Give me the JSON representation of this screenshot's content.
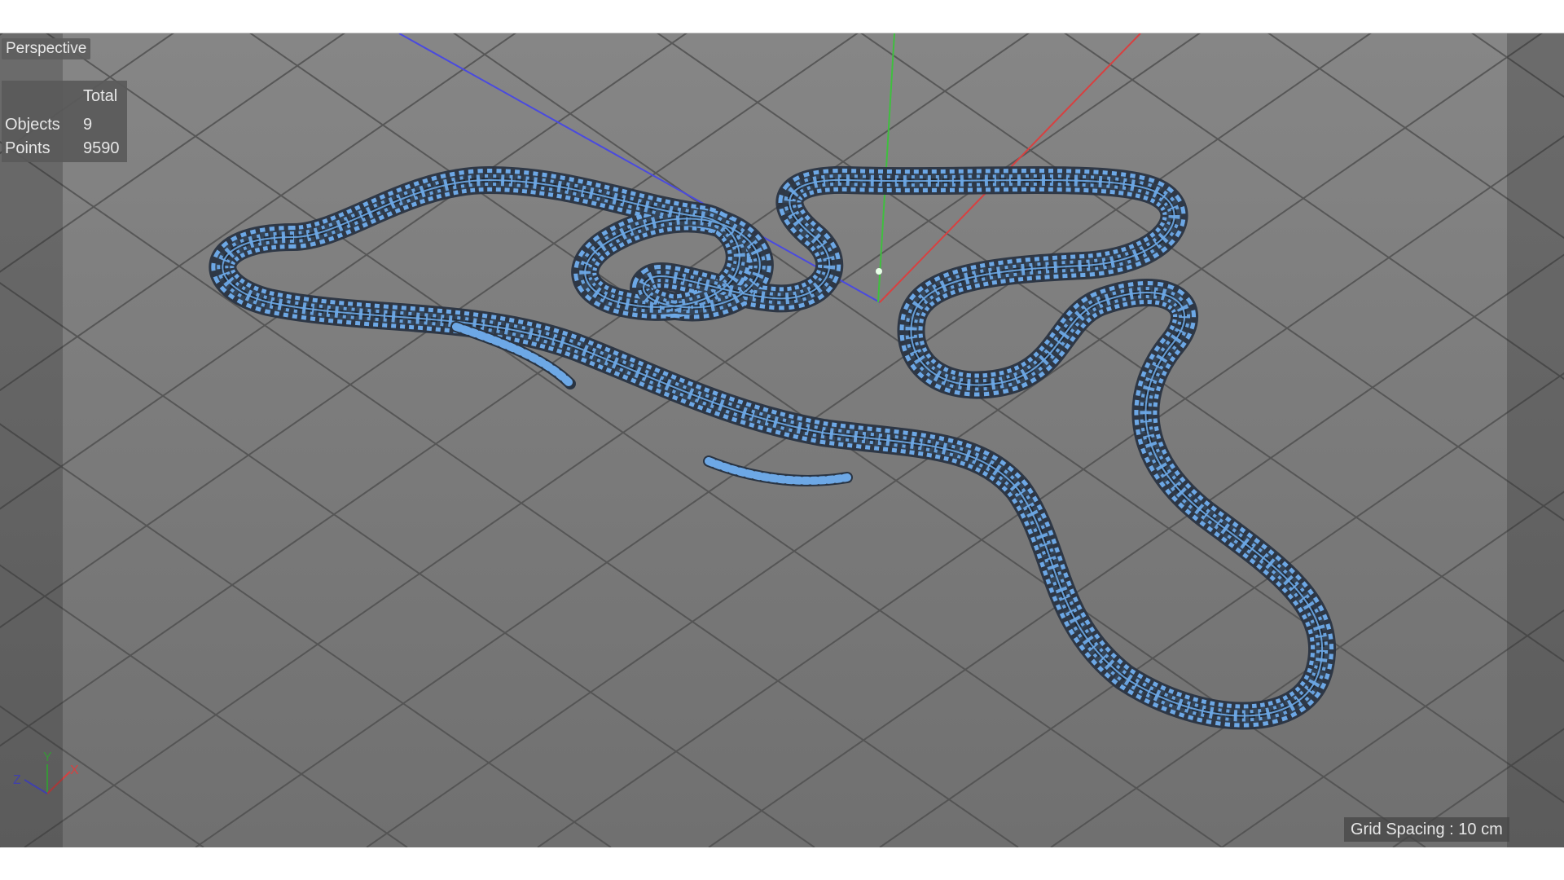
{
  "viewport": {
    "camera_label": "Perspective",
    "grid_status": "Grid Spacing : 10 cm",
    "background_color": "#7a7a7a",
    "grid_line_color": "#505050",
    "spline_color": "#6da8e6"
  },
  "hud": {
    "column_header": "Total",
    "rows": [
      {
        "label": "Objects",
        "value": "9"
      },
      {
        "label": "Points",
        "value": "9590"
      }
    ]
  },
  "axes": {
    "x_label": "X",
    "y_label": "Y",
    "z_label": "Z",
    "x_color": "#d84040",
    "y_color": "#3fbf3f",
    "z_color": "#4a4adf"
  }
}
